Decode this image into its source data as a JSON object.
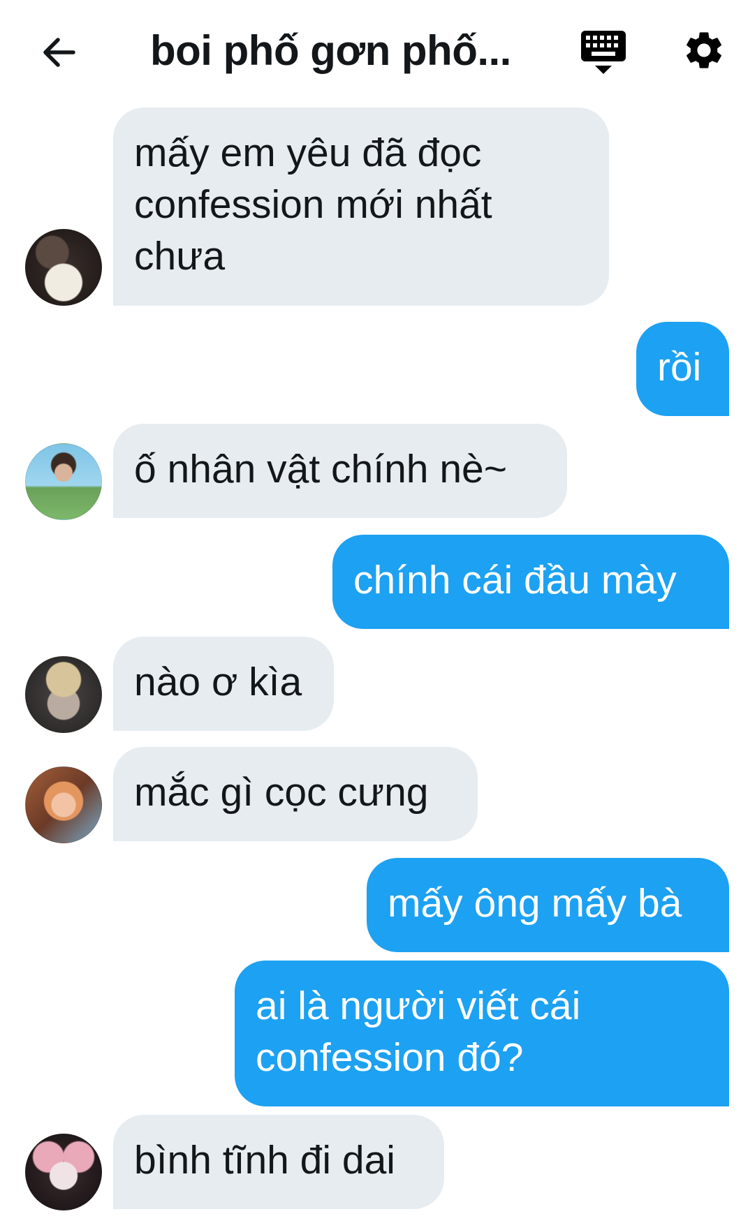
{
  "header": {
    "title": "boi phố gơn phố...",
    "icons": {
      "back": "arrow-left-icon",
      "keyboard": "keyboard-icon",
      "settings": "gear-icon"
    }
  },
  "messages": [
    {
      "side": "in",
      "text": "mấy em yêu đã đọc\nconfession mới nhất\nchưa"
    },
    {
      "side": "out",
      "text": "rồi"
    },
    {
      "side": "in",
      "text": "ố nhân vật chính nè~"
    },
    {
      "side": "out",
      "text": "chính cái đầu mày"
    },
    {
      "side": "in",
      "text": "nào ơ kìa"
    },
    {
      "side": "in",
      "text": "mắc gì cọc cưng"
    },
    {
      "side": "out",
      "text": "mấy ông mấy bà"
    },
    {
      "side": "out",
      "text": "ai là người viết cái\nconfession đó?"
    },
    {
      "side": "in",
      "text": "bình tĩnh đi dai"
    }
  ],
  "colors": {
    "incoming_bubble": "#e6ecf0",
    "outgoing_bubble": "#1da1f2",
    "text_dark": "#14171a"
  }
}
